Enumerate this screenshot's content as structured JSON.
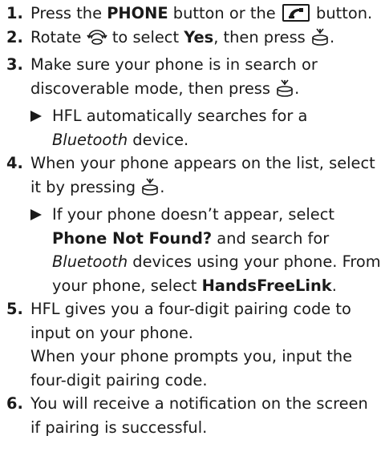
{
  "steps": [
    {
      "num": "1.",
      "t1": "Press the ",
      "b1": "PHONE",
      "t2": " button or the ",
      "t3": " button.",
      "icon": "phone-handset-icon"
    },
    {
      "num": "2.",
      "t1": "Rotate ",
      "t2": " to select ",
      "b1": "Yes",
      "t3": ", then press ",
      "t4": ".",
      "icon_rotate": "rotate-knob-icon",
      "icon_press": "press-knob-icon"
    },
    {
      "num": "3.",
      "t1": "Make sure your phone is in search or discoverable mode, then press ",
      "t2": ".",
      "icon_press": "press-knob-icon",
      "sub": {
        "t1": "HFL automatically searches for a ",
        "i1": "Bluetooth",
        "t2": " device."
      }
    },
    {
      "num": "4.",
      "t1": "When your phone appears on the list, select it by pressing ",
      "t2": ".",
      "icon_press": "press-knob-icon",
      "sub": {
        "t1": "If your phone doesn’t appear, select ",
        "b1": "Phone Not Found?",
        "t2": " and search for ",
        "i1": "Bluetooth",
        "t3": " devices using your phone. From your phone, select ",
        "b2": "HandsFreeLink",
        "t4": "."
      }
    },
    {
      "num": "5.",
      "t1": "HFL gives you a four-digit pairing code to input on your phone.",
      "t2": "When your phone prompts you, input the four-digit pairing code."
    },
    {
      "num": "6.",
      "t1": "You will receive a notification on the screen if pairing is successful."
    }
  ],
  "icons": {
    "phone_button": "phone-handset-icon",
    "rotate": "rotate-knob-icon",
    "press": "press-knob-icon",
    "bullet": "arrow-bullet-icon"
  }
}
